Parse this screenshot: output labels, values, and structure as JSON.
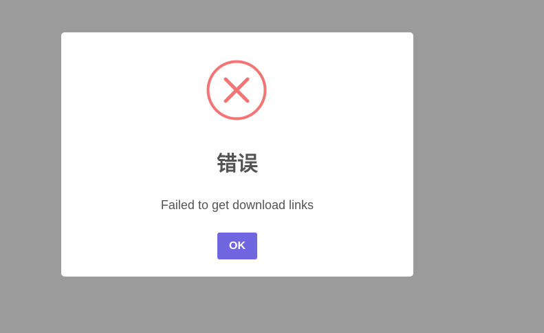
{
  "dialog": {
    "icon": "error-x-circle-icon",
    "icon_color": "#f27474",
    "title": "错误",
    "message": "Failed to get download links",
    "confirm_label": "OK",
    "confirm_color": "#7066e0",
    "backdrop_color": "#9b9b9b"
  }
}
